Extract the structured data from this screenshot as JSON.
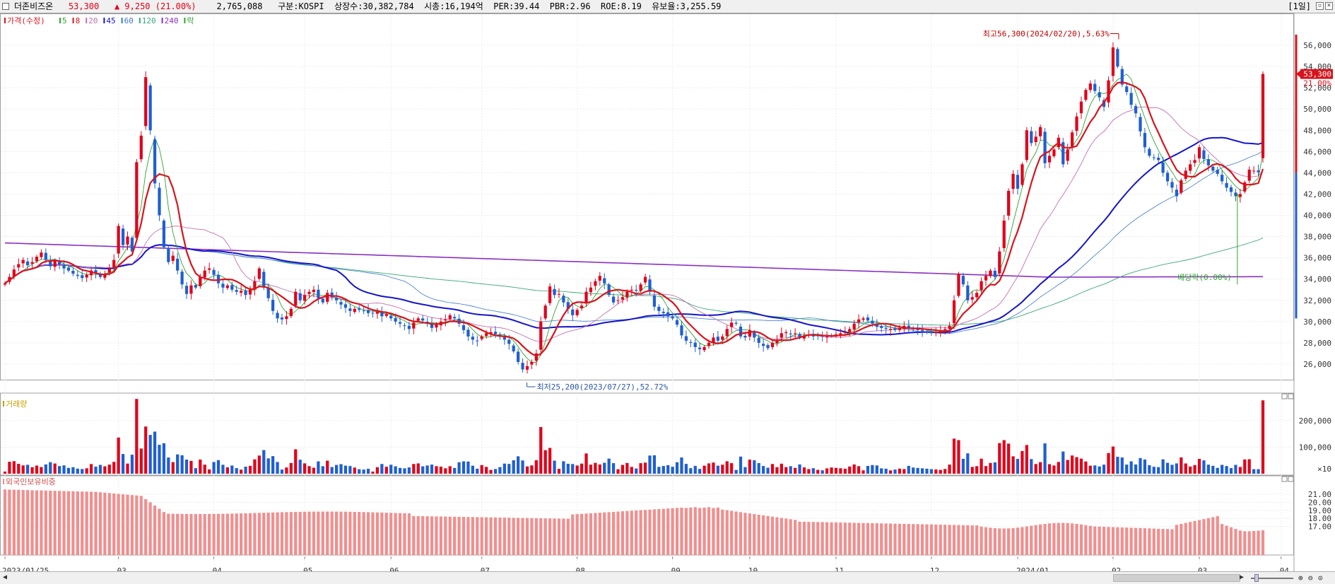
{
  "header": {
    "stock_name": "더존비즈온",
    "price": "53,300",
    "change_arrow": "▲",
    "change": "9,250",
    "change_pct": "(21.00%)",
    "volume": "2,765,088",
    "market": "구분:KOSPI",
    "shares": "상장수:30,382,784",
    "market_cap": "시총:16,194억",
    "per": "PER:39.44",
    "pbr": "PBR:2.96",
    "roe": "ROE:8.19",
    "float": "유보율:3,255.59",
    "period": "[1일]"
  },
  "colors": {
    "up": "#e0001a",
    "down": "#1f5fd0",
    "ma5": "#2fa52f",
    "ma8": "#d7141d",
    "ma20": "#c46fb3",
    "ma45": "#1414c8",
    "ma60": "#3a78c8",
    "ma120": "#3aa878",
    "ma240": "#8a2fc0",
    "foreign": "#f08f8f"
  },
  "chart_data": [
    {
      "type": "candlestick",
      "title": "",
      "legend": [
        {
          "label": "가격(수정)",
          "color": "#d7141d"
        },
        {
          "label": "5",
          "color": "#2fa52f"
        },
        {
          "label": "8",
          "color": "#d7141d"
        },
        {
          "label": "20",
          "color": "#c46fb3"
        },
        {
          "label": "45",
          "color": "#1414c8"
        },
        {
          "label": "60",
          "color": "#3a78c8"
        },
        {
          "label": "120",
          "color": "#3aa878"
        },
        {
          "label": "240",
          "color": "#8a2fc0"
        },
        {
          "label": "락",
          "color": "#2fa52f"
        }
      ],
      "y_ticks": [
        "56,000",
        "54,000",
        "52,000",
        "50,000",
        "48,000",
        "46,000",
        "44,000",
        "42,000",
        "40,000",
        "38,000",
        "36,000",
        "34,000",
        "32,000",
        "30,000",
        "28,000",
        "26,000"
      ],
      "ylim": [
        24200,
        57600
      ],
      "x_ticks": [
        {
          "label": "2023/01/25",
          "i": 0
        },
        {
          "label": "03",
          "i": 25
        },
        {
          "label": "04",
          "i": 46
        },
        {
          "label": "05",
          "i": 66
        },
        {
          "label": "06",
          "i": 85
        },
        {
          "label": "07",
          "i": 105
        },
        {
          "label": "08",
          "i": 126
        },
        {
          "label": "09",
          "i": 147
        },
        {
          "label": "10",
          "i": 164
        },
        {
          "label": "11",
          "i": 183
        },
        {
          "label": "12",
          "i": 204
        },
        {
          "label": "2024/01",
          "i": 223
        },
        {
          "label": "02",
          "i": 244
        },
        {
          "label": "03",
          "i": 263
        },
        {
          "label": "04",
          "i": 281
        }
      ],
      "closes": [
        33600,
        34200,
        34900,
        35400,
        35800,
        35300,
        35600,
        36100,
        36500,
        35800,
        35200,
        35700,
        35400,
        35000,
        34800,
        34500,
        34300,
        34100,
        34400,
        34800,
        34600,
        34200,
        34500,
        35000,
        35800,
        39000,
        37200,
        38000,
        36600,
        45000,
        47500,
        53000,
        48000,
        43000,
        40000,
        37000,
        35600,
        36200,
        34800,
        33500,
        32600,
        33400,
        33200,
        34200,
        34800,
        35000,
        34400,
        33600,
        33200,
        33400,
        33000,
        32800,
        32900,
        32500,
        33000,
        33800,
        35000,
        33200,
        32200,
        31000,
        30300,
        30200,
        30500,
        31200,
        32800,
        32000,
        32500,
        32800,
        33000,
        32200,
        31800,
        32700,
        32300,
        32000,
        31600,
        31300,
        31000,
        31200,
        31100,
        31000,
        30800,
        30800,
        30900,
        30500,
        30700,
        30300,
        30000,
        29800,
        29600,
        29300,
        29900,
        30300,
        30100,
        29800,
        29400,
        29700,
        30000,
        30200,
        30600,
        30300,
        29800,
        29200,
        28600,
        28300,
        28200,
        28600,
        28900,
        29000,
        28800,
        28700,
        28300,
        27900,
        27200,
        26200,
        25500,
        25800,
        26200,
        27000,
        30000,
        31500,
        33300,
        32500,
        32600,
        31800,
        31200,
        30600,
        31100,
        31500,
        32800,
        33200,
        33800,
        34300,
        33600,
        32500,
        31800,
        32000,
        32300,
        32800,
        33000,
        32900,
        33500,
        34200,
        32800,
        31400,
        31000,
        30800,
        30500,
        30300,
        29700,
        28700,
        28200,
        28000,
        27600,
        27400,
        27600,
        28000,
        28500,
        28200,
        28600,
        29300,
        29900,
        29800,
        28600,
        28500,
        29200,
        28500,
        28000,
        27700,
        27500,
        28000,
        28300,
        28900,
        29000,
        28800,
        28900,
        28500,
        28700,
        28800,
        28600,
        28700,
        28600,
        28600,
        28700,
        28800,
        28900,
        29000,
        29300,
        29800,
        30200,
        30300,
        30100,
        29800,
        29500,
        29400,
        29300,
        29300,
        29200,
        29400,
        29600,
        29400,
        29300,
        29200,
        29100,
        29000,
        28900,
        29000,
        29100,
        29300,
        29600,
        32000,
        34500,
        33500,
        32000,
        32300,
        32700,
        33800,
        34300,
        34800,
        34200,
        36600,
        39500,
        42300,
        43900,
        42500,
        44800,
        48000,
        46800,
        47400,
        48300,
        44900,
        45600,
        46200,
        47300,
        44800,
        46200,
        47800,
        49300,
        50700,
        51800,
        52400,
        51700,
        51100,
        50200,
        52700,
        55800,
        54000,
        52300,
        51600,
        50400,
        49600,
        47900,
        46400,
        45600,
        45400,
        45200,
        44000,
        43200,
        42600,
        41800,
        43300,
        44200,
        44800,
        45200,
        46400,
        45300,
        44700,
        44200,
        43900,
        43200,
        42600,
        42200,
        41800,
        42000,
        43100,
        44300,
        44200,
        44050,
        53300
      ],
      "volume_ticks": [
        "200,000",
        "100,000",
        "×10"
      ],
      "volume_max": 290000,
      "foreign_ticks": [
        "21.00",
        "20.00",
        "19.00",
        "18.00",
        "17.00"
      ],
      "foreign_range": [
        16.0,
        21.8
      ],
      "annotations": {
        "high": "최고56,300(2024/02/20),5.63%",
        "low": "최저25,200(2023/07/27),52.72%",
        "dividend": "배당락(0.00%)",
        "last_price": "53,300",
        "last_pct": "21.00%"
      }
    }
  ],
  "panels": {
    "volume_title": "거래량",
    "foreign_title": "외국인보유비중"
  }
}
